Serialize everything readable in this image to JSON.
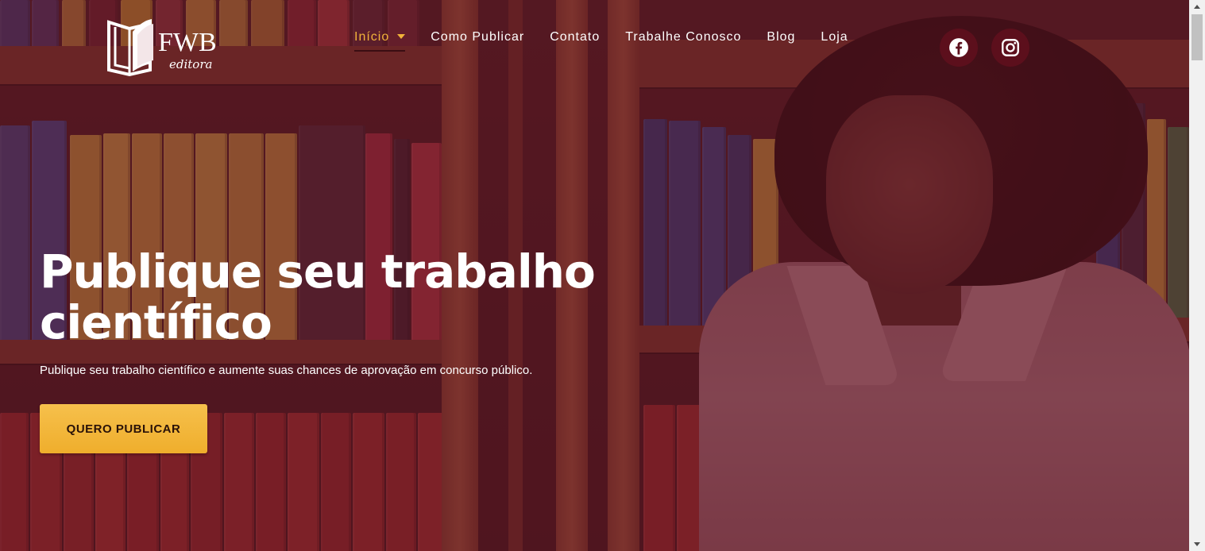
{
  "brand": {
    "logo_main": "FWB",
    "logo_sub": "editora",
    "primary_color": "#5c0f1c",
    "accent_color": "#f1b33a"
  },
  "nav": {
    "items": [
      {
        "label": "Início",
        "active": true,
        "has_dropdown": true
      },
      {
        "label": "Como Publicar",
        "active": false
      },
      {
        "label": "Contato",
        "active": false
      },
      {
        "label": "Trabalhe Conosco",
        "active": false
      },
      {
        "label": "Blog",
        "active": false
      },
      {
        "label": "Loja",
        "active": false
      }
    ]
  },
  "social": [
    {
      "icon": "facebook-icon"
    },
    {
      "icon": "instagram-icon"
    }
  ],
  "hero": {
    "title": "Publique seu trabalho científico",
    "subtitle": "Publique seu trabalho científico e aumente suas chances de aprovação em concurso público.",
    "cta_label": "QUERO PUBLICAR"
  }
}
